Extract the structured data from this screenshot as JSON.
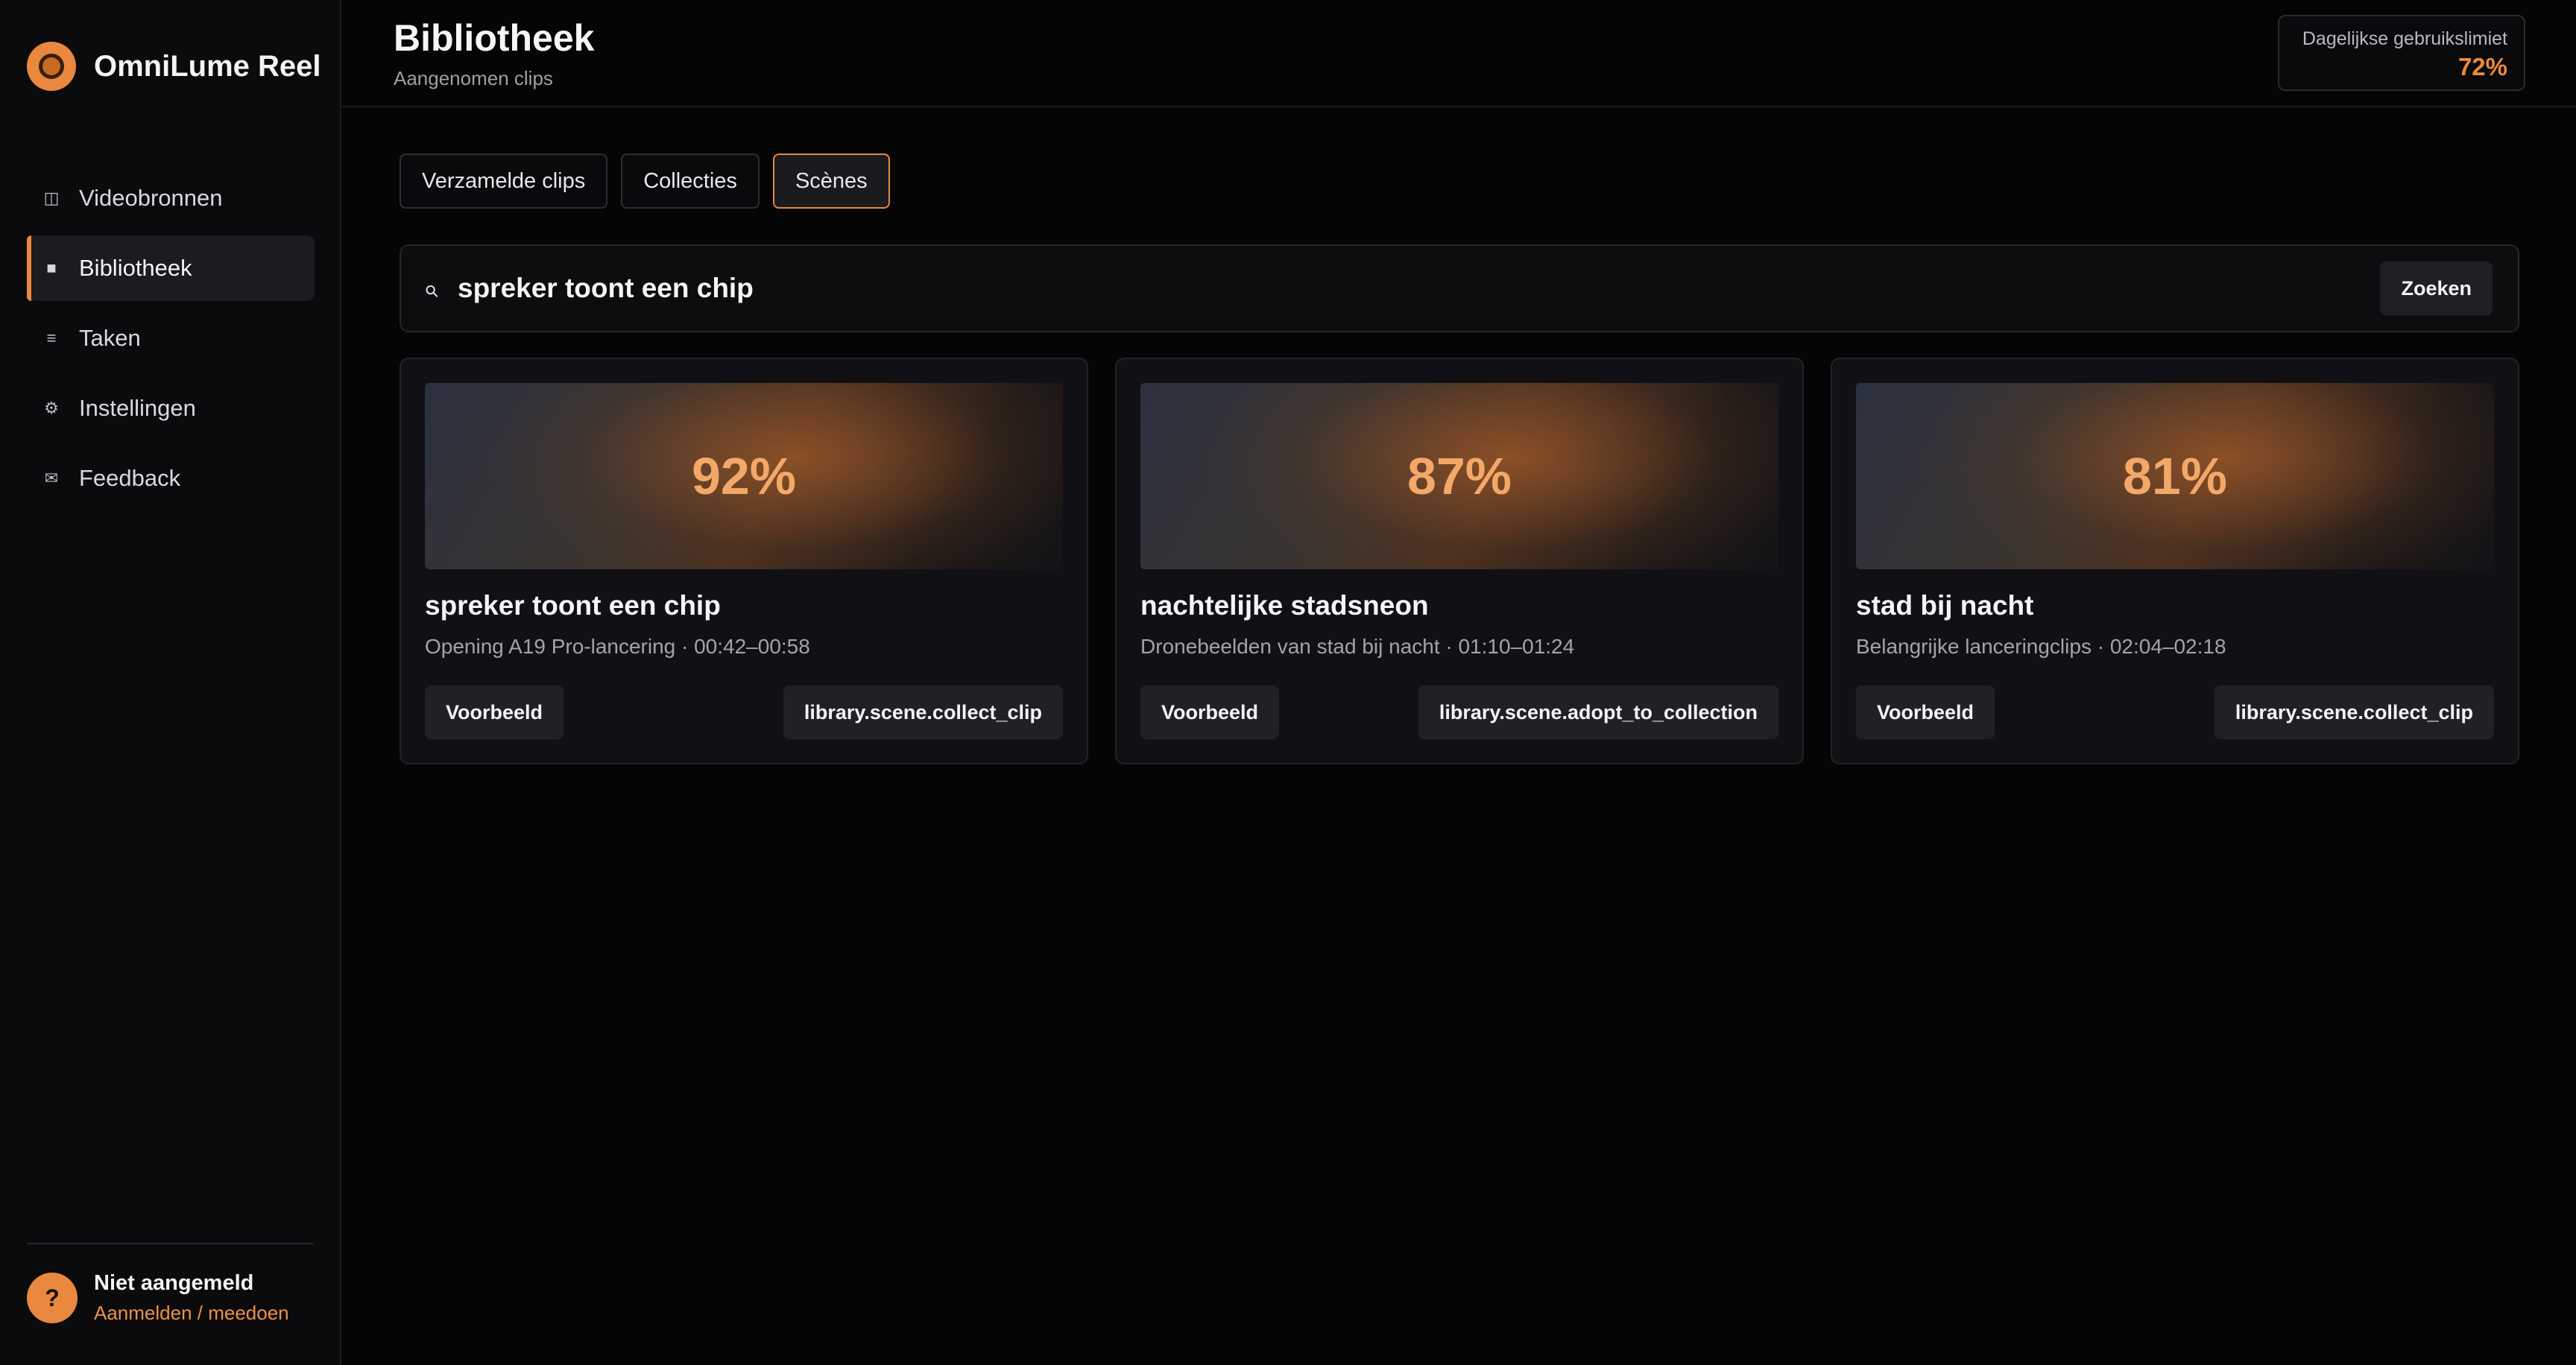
{
  "app": {
    "name": "OmniLume Reel"
  },
  "sidebar": {
    "items": [
      {
        "label": "Videobronnen",
        "icon": "columns-icon",
        "glyph": "◫"
      },
      {
        "label": "Bibliotheek",
        "icon": "square-icon",
        "glyph": "■"
      },
      {
        "label": "Taken",
        "icon": "list-icon",
        "glyph": "≡"
      },
      {
        "label": "Instellingen",
        "icon": "gear-icon",
        "glyph": "⚙"
      },
      {
        "label": "Feedback",
        "icon": "mail-icon",
        "glyph": "✉"
      }
    ],
    "active_item": "Bibliotheek"
  },
  "user": {
    "avatar": "?",
    "name": "Niet aangemeld",
    "link": "Aanmelden / meedoen"
  },
  "header": {
    "title": "Bibliotheek",
    "subtitle": "Aangenomen clips",
    "usage": {
      "label": "Dagelijkse gebruikslimiet",
      "value": "72%"
    }
  },
  "tabs": [
    {
      "label": "Verzamelde clips"
    },
    {
      "label": "Collecties"
    },
    {
      "label": "Scènes"
    }
  ],
  "active_tab": "Scènes",
  "search": {
    "icon": "search-icon",
    "glyph": "⚲",
    "value": "spreker toont een chip",
    "button_label": "Zoeken"
  },
  "cards": [
    {
      "score": "92%",
      "title": "spreker toont een chip",
      "meta": "Opening A19 Pro-lancering · 00:42–00:58",
      "preview_label": "Voorbeeld",
      "action_label": "library.scene.collect_clip"
    },
    {
      "score": "87%",
      "title": "nachtelijke stadsneon",
      "meta": "Dronebeelden van stad bij nacht · 01:10–01:24",
      "preview_label": "Voorbeeld",
      "action_label": "library.scene.adopt_to_collection"
    },
    {
      "score": "81%",
      "title": "stad bij nacht",
      "meta": "Belangrijke lanceringclips · 02:04–02:18",
      "preview_label": "Voorbeeld",
      "action_label": "library.scene.collect_clip"
    }
  ],
  "colors": {
    "accent": "#e9883e",
    "score": "#f3a869",
    "background": "#050506"
  }
}
